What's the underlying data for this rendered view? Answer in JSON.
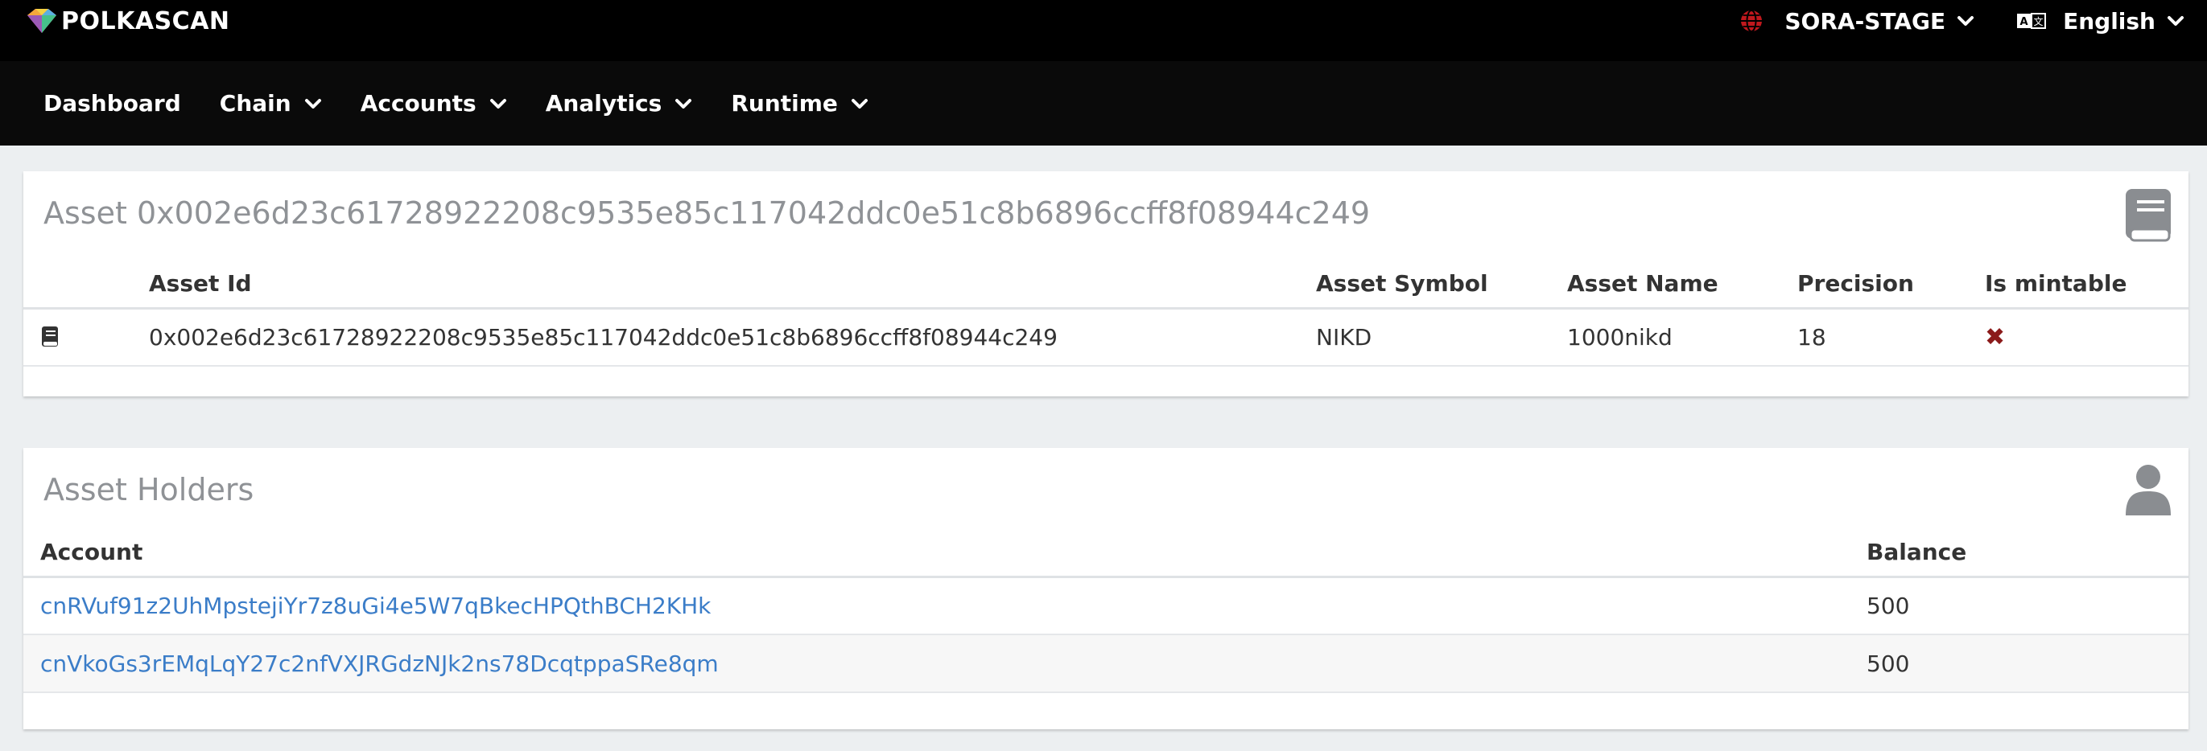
{
  "header": {
    "brand": "POLKASCAN",
    "network": "SORA-STAGE",
    "language": "English"
  },
  "nav": {
    "items": [
      {
        "label": "Dashboard",
        "dropdown": false
      },
      {
        "label": "Chain",
        "dropdown": true
      },
      {
        "label": "Accounts",
        "dropdown": true
      },
      {
        "label": "Analytics",
        "dropdown": true
      },
      {
        "label": "Runtime",
        "dropdown": true
      }
    ]
  },
  "asset_card": {
    "title": "Asset 0x002e6d23c61728922208c9535e85c117042ddc0e51c8b6896ccff8f08944c249",
    "icon": "book-icon",
    "columns": [
      "Asset Id",
      "Asset Symbol",
      "Asset Name",
      "Precision",
      "Is mintable"
    ],
    "row": {
      "icon": "book-icon",
      "asset_id": "0x002e6d23c61728922208c9535e85c117042ddc0e51c8b6896ccff8f08944c249",
      "symbol": "NIKD",
      "name": "1000nikd",
      "precision": "18",
      "is_mintable_icon": "cross-icon",
      "is_mintable_glyph": "✖"
    }
  },
  "holders_card": {
    "title": "Asset Holders",
    "icon": "user-icon",
    "columns": [
      "Account",
      "Balance"
    ],
    "rows": [
      {
        "account": "cnRVuf91z2UhMpstejiYr7z8uGi4e5W7qBkecHPQthBCH2KHk",
        "balance": "500"
      },
      {
        "account": "cnVkoGs3rEMqLqY27c2nfVXJRGdzNJk2ns78DcqtppaSRe8qm",
        "balance": "500"
      }
    ]
  },
  "colors": {
    "topbar": "#000000",
    "navbar": "#0a0a0a",
    "link": "#3b7dc8",
    "mintable_false": "#8b1a1a",
    "page_bg": "#eceff1"
  }
}
